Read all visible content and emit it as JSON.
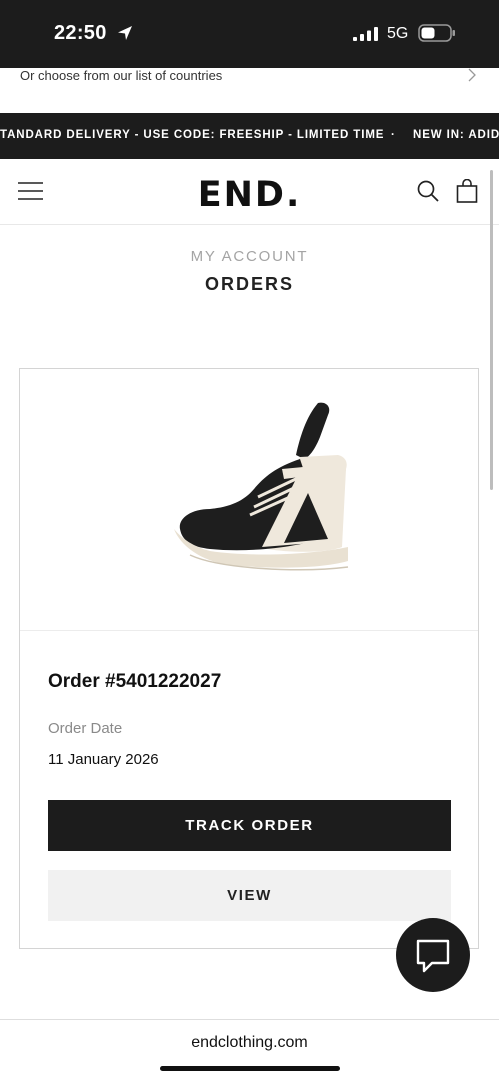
{
  "status_bar": {
    "time": "22:50",
    "network": "5G"
  },
  "country_strip": {
    "text": "Or choose from our list of countries"
  },
  "promo": {
    "text": "TANDARD DELIVERY - USE CODE: FREESHIP - LIMITED TIME",
    "separator": "·",
    "text_2": "NEW IN: ADIDAS"
  },
  "header": {
    "logo": "END."
  },
  "page": {
    "breadcrumb": "MY ACCOUNT",
    "title": "ORDERS"
  },
  "order": {
    "number": "Order #5401222027",
    "date_label": "Order Date",
    "date_value": "11 January 2026",
    "track_label": "TRACK ORDER",
    "view_label": "VIEW",
    "product_image_alt": "black and white high-top sneaker"
  },
  "browser": {
    "url": "endclothing.com"
  },
  "colors": {
    "dark": "#1c1c1c",
    "muted": "#a4a4a4",
    "button_light": "#f1f1f1"
  },
  "icons": [
    "location-arrow-icon",
    "signal-icon",
    "battery-icon",
    "chevron-right-icon",
    "menu-icon",
    "search-icon",
    "bag-icon",
    "chat-icon"
  ]
}
